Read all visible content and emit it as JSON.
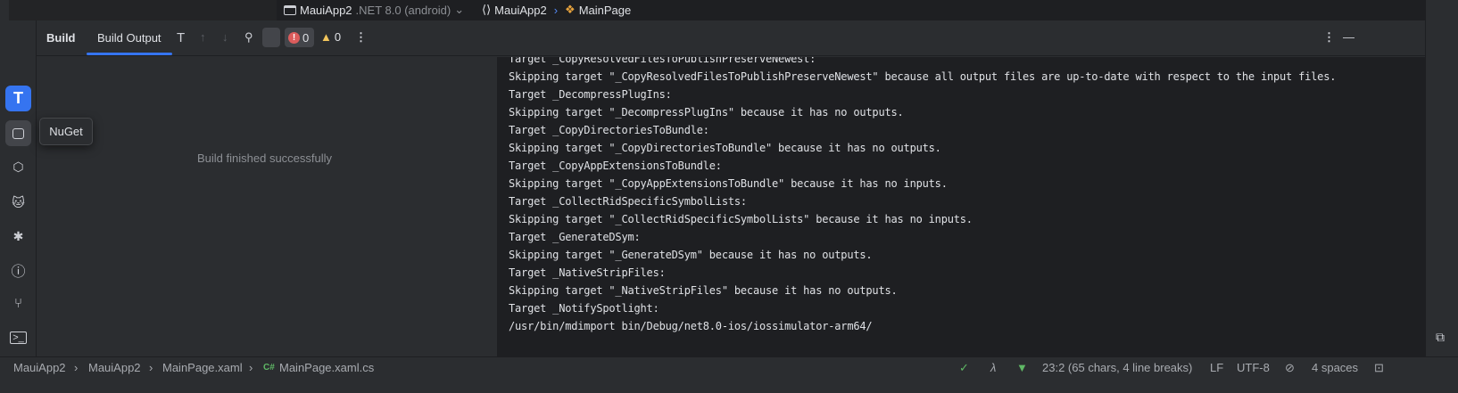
{
  "topbar": {
    "project": "MauiApp2",
    "framework": ".NET 8.0 (android)",
    "namespace": "MauiApp2",
    "class": "MainPage"
  },
  "panel": {
    "tabs": [
      {
        "label": "Build"
      },
      {
        "label": "Build Output",
        "active": true
      }
    ],
    "error_count": "0",
    "warning_count": "0",
    "empty_message": "Build finished successfully"
  },
  "tooltip": "NuGet",
  "output_lines": [
    "Target _CopyResolvedFilesToPublishPreserveNewest:",
    "Skipping target \"_CopyResolvedFilesToPublishPreserveNewest\" because all output files are up-to-date with respect to the input files.",
    "Target _DecompressPlugIns:",
    "Skipping target \"_DecompressPlugIns\" because it has no outputs.",
    "Target _CopyDirectoriesToBundle:",
    "Skipping target \"_CopyDirectoriesToBundle\" because it has no outputs.",
    "Target _CopyAppExtensionsToBundle:",
    "Skipping target \"_CopyAppExtensionsToBundle\" because it has no inputs.",
    "Target _CollectRidSpecificSymbolLists:",
    "Skipping target \"_CollectRidSpecificSymbolLists\" because it has no inputs.",
    "Target _GenerateDSym:",
    "Skipping target \"_GenerateDSym\" because it has no outputs.",
    "Target _NativeStripFiles:",
    "Skipping target \"_NativeStripFiles\" because it has no outputs.",
    "Target _NotifySpotlight:",
    "/usr/bin/mdimport bin/Debug/net8.0-ios/iossimulator-arm64/"
  ],
  "status": {
    "breadcrumb": [
      "MauiApp2",
      "MauiApp2",
      "MainPage.xaml"
    ],
    "file_lang": "C#",
    "file": "MainPage.xaml.cs",
    "position": "23:2 (65 chars, 4 line breaks)",
    "line_ending": "LF",
    "encoding": "UTF-8",
    "indent": "4 spaces"
  },
  "colors": {
    "accent": "#3574f0",
    "error": "#db5c5c",
    "warning": "#f2c55c",
    "ok": "#5fb865"
  }
}
